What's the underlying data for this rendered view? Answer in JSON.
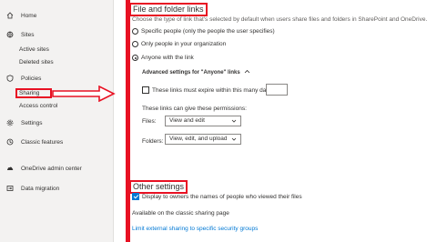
{
  "nav": {
    "home": "Home",
    "sites": "Sites",
    "active_sites": "Active sites",
    "deleted_sites": "Deleted sites",
    "policies": "Policies",
    "sharing": "Sharing",
    "access_control": "Access control",
    "settings": "Settings",
    "classic_features": "Classic features",
    "onedrive_admin_center": "OneDrive admin center",
    "data_migration": "Data migration"
  },
  "file_folder": {
    "title": "File and folder links",
    "description": "Choose the type of link that's selected by default when users share files and folders in SharePoint and OneDrive.",
    "options": [
      {
        "label": "Specific people (only the people the user specifies)",
        "selected": false
      },
      {
        "label": "Only people in your organization",
        "selected": false
      },
      {
        "label": "Anyone with the link",
        "selected": true
      }
    ],
    "advanced_label": "Advanced settings for \"Anyone\" links",
    "expire_label": "These links must expire within this many days",
    "expire_checked": false,
    "permissions_label": "These links can give these permissions:",
    "files_label": "Files:",
    "files_value": "View and edit",
    "folders_label": "Folders:",
    "folders_value": "View, edit, and upload"
  },
  "other": {
    "title": "Other settings",
    "display_owners_label": "Display to owners the names of people who viewed their files",
    "display_owners_checked": true,
    "classic_label": "Available on the classic sharing page",
    "limit_link": "Limit external sharing to specific security groups"
  },
  "colors": {
    "highlight": "#e81123",
    "accent": "#0078d4",
    "nav_bg": "#f3f2f1"
  }
}
